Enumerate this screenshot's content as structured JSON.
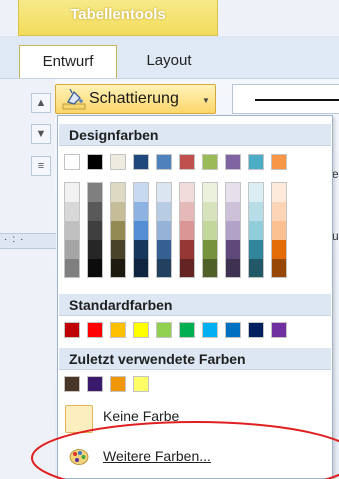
{
  "ribbon": {
    "context_title": "Tabellentools",
    "tabs": [
      {
        "label": "Entwurf",
        "active": true
      },
      {
        "label": "Layout",
        "active": false
      }
    ],
    "shading_button": {
      "label": "Schattierung",
      "accent": "#fbd66a"
    },
    "right_fragments": [
      "e",
      "u"
    ]
  },
  "menu": {
    "design_header": "Designfarben",
    "design_top_row": [
      "#ffffff",
      "#000000",
      "#eeece1",
      "#1f497d",
      "#4f81bd",
      "#c0504d",
      "#9bbb59",
      "#8064a2",
      "#4bacc6",
      "#f79646"
    ],
    "design_shades": [
      [
        "#f2f2f2",
        "#d8d8d8",
        "#bfbfbf",
        "#a5a5a5",
        "#7f7f7f"
      ],
      [
        "#7f7f7f",
        "#595959",
        "#3f3f3f",
        "#262626",
        "#0c0c0c"
      ],
      [
        "#ddd9c3",
        "#c4bd97",
        "#938953",
        "#494429",
        "#1d1b10"
      ],
      [
        "#c6d9f0",
        "#8db3e2",
        "#548dd4",
        "#17365d",
        "#0f243e"
      ],
      [
        "#dbe5f1",
        "#b8cce4",
        "#95b3d7",
        "#366092",
        "#244061"
      ],
      [
        "#f2dcdb",
        "#e5b9b7",
        "#d99694",
        "#953734",
        "#632423"
      ],
      [
        "#ebf1dd",
        "#d7e3bc",
        "#c3d69b",
        "#76923c",
        "#4f6128"
      ],
      [
        "#e5e0ec",
        "#ccc1d9",
        "#b2a2c7",
        "#5f497a",
        "#3f3151"
      ],
      [
        "#dbeef3",
        "#b7dde8",
        "#92cddc",
        "#31859b",
        "#205867"
      ],
      [
        "#fdeada",
        "#fbd5b5",
        "#fac08f",
        "#e36c09",
        "#974806"
      ]
    ],
    "standard_header": "Standardfarben",
    "standard_colors": [
      "#c00000",
      "#ff0000",
      "#ffc000",
      "#ffff00",
      "#92d050",
      "#00b050",
      "#00b0f0",
      "#0070c0",
      "#002060",
      "#7030a0"
    ],
    "recent_header": "Zuletzt verwendete Farben",
    "recent_colors": [
      "#4a3728",
      "#3b1a6e",
      "#f0960a",
      "#ffff66"
    ],
    "no_color_label": "Keine Farbe",
    "more_colors_label": "Weitere Farben...",
    "highlight_color": "#e02020"
  }
}
